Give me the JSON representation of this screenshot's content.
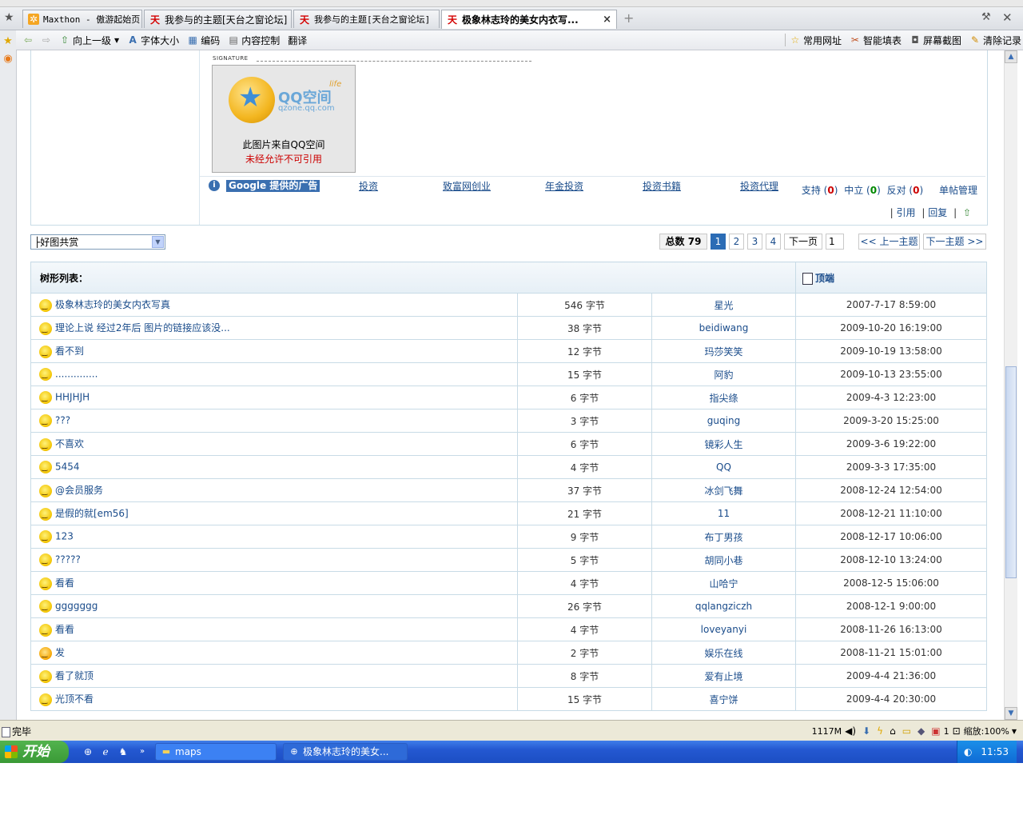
{
  "browser": {
    "tabs": [
      {
        "label": "Maxthon - 傲游起始页",
        "icon": "maxthon-icon"
      },
      {
        "label": "我参与的主题[天台之窗论坛]",
        "icon": "forum-icon"
      },
      {
        "label": "我参与的主题[天台之窗论坛]",
        "icon": "forum-icon"
      },
      {
        "label": "极象林志玲的美女内衣写...",
        "icon": "forum-icon"
      }
    ],
    "tab_close": "×",
    "new_tab": "+",
    "nav": {
      "up": "向上一级",
      "font_size": "字体大小",
      "encoding": "编码",
      "content_control": "内容控制",
      "translate": "翻译",
      "common_sites": "常用网址",
      "smart_fill": "智能填表",
      "screenshot": "屏幕截图",
      "clear_records": "清除记录"
    }
  },
  "post": {
    "signature_label": "SIGNATURE",
    "image": {
      "brand": "QQ空间",
      "domain": "qzone.qq.com",
      "life": "life",
      "line1": "此图片来自QQ空间",
      "line2": "未经允许不可引用"
    },
    "ads": {
      "label": "Google 提供的广告",
      "links": [
        "投资",
        "致富网创业",
        "年金投资",
        "投资书籍",
        "投资代理"
      ]
    },
    "votes": {
      "support_label": "支持",
      "support_count": "0",
      "neutral_label": "中立",
      "neutral_count": "0",
      "oppose_label": "反对",
      "oppose_count": "0",
      "manage_label": "单帖管理"
    },
    "actions": {
      "quote": "引用",
      "reply": "回复"
    }
  },
  "forum_select": {
    "selected": "├好图共赏"
  },
  "pager": {
    "total_label": "总数",
    "total": "79",
    "pages": [
      "1",
      "2",
      "3",
      "4"
    ],
    "current": "1",
    "next_page": "下一页",
    "goto_value": "1",
    "prev_topic": "<< 上一主题",
    "next_topic": "下一主题 >>"
  },
  "tree": {
    "title": "树形列表：",
    "top_label": "顶端",
    "rows": [
      {
        "title": "极象林志玲的美女内衣写真",
        "size": "546 字节",
        "author": "星光",
        "time": "2007-7-17 8:59:00"
      },
      {
        "title": "理论上说 经过2年后 图片的链接应该没...",
        "size": "38 字节",
        "author": "beidiwang",
        "time": "2009-10-20 16:19:00"
      },
      {
        "title": "看不到",
        "size": "12 字节",
        "author": "玛莎笑笑",
        "time": "2009-10-19 13:58:00"
      },
      {
        "title": "..............",
        "size": "15 字节",
        "author": "阿豹",
        "time": "2009-10-13 23:55:00"
      },
      {
        "title": "HHJHJH",
        "size": "6 字节",
        "author": "指尖绦",
        "time": "2009-4-3 12:23:00"
      },
      {
        "title": "???",
        "size": "3 字节",
        "author": "guqing",
        "time": "2009-3-20 15:25:00"
      },
      {
        "title": "不喜欢",
        "size": "6 字节",
        "author": "镜彩人生",
        "time": "2009-3-6 19:22:00"
      },
      {
        "title": "5454",
        "size": "4 字节",
        "author": "QQ",
        "time": "2009-3-3 17:35:00"
      },
      {
        "title": "@会员服务",
        "size": "37 字节",
        "author": "冰剑飞舞",
        "time": "2008-12-24 12:54:00"
      },
      {
        "title": "是假的就[em56]",
        "size": "21 字节",
        "author": "11",
        "time": "2008-12-21 11:10:00"
      },
      {
        "title": "123",
        "size": "9 字节",
        "author": "布丁男孩",
        "time": "2008-12-17 10:06:00"
      },
      {
        "title": "?????",
        "size": "5 字节",
        "author": "胡同小巷",
        "time": "2008-12-10 13:24:00"
      },
      {
        "title": "看看",
        "size": "4 字节",
        "author": "山哈宁",
        "time": "2008-12-5 15:06:00"
      },
      {
        "title": "ggggggg",
        "size": "26 字节",
        "author": "qqlangziczh",
        "time": "2008-12-1 9:00:00"
      },
      {
        "title": "看看",
        "size": "4 字节",
        "author": "loveyanyi",
        "time": "2008-11-26 16:13:00"
      },
      {
        "title": "发",
        "size": "2 字节",
        "author": "娱乐在线",
        "time": "2008-11-21 15:01:00"
      },
      {
        "title": "看了就顶",
        "size": "8 字节",
        "author": "爱有止境",
        "time": "2009-4-4 21:36:00"
      },
      {
        "title": "光顶不看",
        "size": "15 字节",
        "author": "喜宁饼",
        "time": "2009-4-4 20:30:00"
      }
    ]
  },
  "status_bar": {
    "text": "完毕",
    "memory": "1117M",
    "zoom_label": "缩放:",
    "zoom": "100%",
    "count": "1"
  },
  "taskbar": {
    "start": "开始",
    "tasks": [
      {
        "label": "maps",
        "icon": "folder-icon"
      },
      {
        "label": "极象林志玲的美女...",
        "icon": "browser-icon"
      }
    ],
    "clock": "11:53"
  },
  "colors": {
    "link": "#1a4c8b",
    "border": "#c8dbe6",
    "accent": "#2b6cb5",
    "taskbar": "#2458d1"
  }
}
